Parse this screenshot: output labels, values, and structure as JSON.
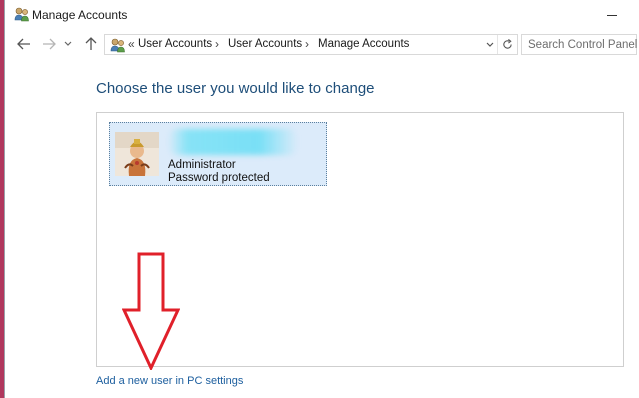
{
  "window": {
    "title": "Manage Accounts"
  },
  "nav": {
    "back_icon": "back-arrow-icon",
    "forward_icon": "forward-arrow-icon",
    "recent_icon": "chevron-down-icon",
    "up_icon": "up-arrow-icon"
  },
  "address": {
    "overflow_chevron": "«",
    "crumbs": [
      "User Accounts",
      "User Accounts",
      "Manage Accounts"
    ],
    "separator": "›"
  },
  "search": {
    "placeholder": "Search Control Panel"
  },
  "main": {
    "heading": "Choose the user you would like to change",
    "accounts": [
      {
        "type": "Administrator",
        "status": "Password protected"
      }
    ],
    "add_user_link": "Add a new user in PC settings"
  },
  "colors": {
    "heading": "#1e4e79",
    "link": "#1c5e9e",
    "tile_bg": "#dcebfa",
    "annotation_arrow": "#e0202a"
  }
}
